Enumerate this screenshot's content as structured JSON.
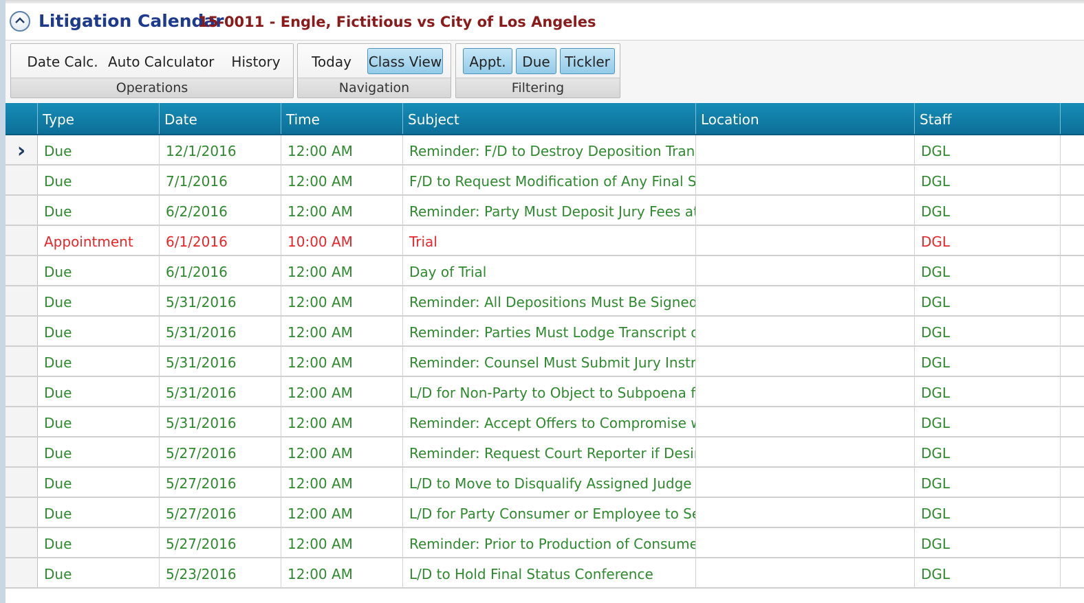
{
  "header": {
    "title": "Litigation Calendar",
    "case": "15-0011 - Engle, Fictitious vs City of Los Angeles"
  },
  "ribbon": {
    "operations": {
      "label": "Operations",
      "buttons": [
        "Date Calc.",
        "Auto Calculator",
        "History"
      ]
    },
    "navigation": {
      "label": "Navigation",
      "buttons": [
        "Today",
        "Class View"
      ],
      "active": "Class View"
    },
    "filtering": {
      "label": "Filtering",
      "buttons": [
        "Appt.",
        "Due",
        "Tickler"
      ],
      "active": [
        "Appt.",
        "Due",
        "Tickler"
      ]
    }
  },
  "grid": {
    "columns": [
      "Type",
      "Date",
      "Time",
      "Subject",
      "Location",
      "Staff"
    ],
    "current_row_indicator": "›",
    "rows": [
      {
        "type": "Due",
        "date": "12/1/2016",
        "time": "12:00 AM",
        "subject": "Reminder: F/D to Destroy Deposition Transc",
        "location": "",
        "staff": "DGL",
        "current": true
      },
      {
        "type": "Due",
        "date": "7/1/2016",
        "time": "12:00 AM",
        "subject": "F/D to Request Modification of Any Final Sta",
        "location": "",
        "staff": "DGL"
      },
      {
        "type": "Due",
        "date": "6/2/2016",
        "time": "12:00 AM",
        "subject": "Reminder: Party Must Deposit Jury Fees at B",
        "location": "",
        "staff": "DGL"
      },
      {
        "type": "Appointment",
        "date": "6/1/2016",
        "time": "10:00 AM",
        "subject": "Trial",
        "location": "",
        "staff": "DGL"
      },
      {
        "type": "Due",
        "date": "6/1/2016",
        "time": "12:00 AM",
        "subject": "Day of Trial",
        "location": "",
        "staff": "DGL"
      },
      {
        "type": "Due",
        "date": "5/31/2016",
        "time": "12:00 AM",
        "subject": "Reminder: All Depositions Must Be Signed a",
        "location": "",
        "staff": "DGL"
      },
      {
        "type": "Due",
        "date": "5/31/2016",
        "time": "12:00 AM",
        "subject": "Reminder: Parties Must Lodge Transcript of",
        "location": "",
        "staff": "DGL"
      },
      {
        "type": "Due",
        "date": "5/31/2016",
        "time": "12:00 AM",
        "subject": "Reminder: Counsel Must Submit Jury Instruc",
        "location": "",
        "staff": "DGL"
      },
      {
        "type": "Due",
        "date": "5/31/2016",
        "time": "12:00 AM",
        "subject": "L/D for Non-Party to Object to Subpoena fo",
        "location": "",
        "staff": "DGL"
      },
      {
        "type": "Due",
        "date": "5/31/2016",
        "time": "12:00 AM",
        "subject": "Reminder: Accept Offers to Compromise wit",
        "location": "",
        "staff": "DGL"
      },
      {
        "type": "Due",
        "date": "5/27/2016",
        "time": "12:00 AM",
        "subject": "Reminder: Request Court Reporter if Desired",
        "location": "",
        "staff": "DGL"
      },
      {
        "type": "Due",
        "date": "5/27/2016",
        "time": "12:00 AM",
        "subject": "L/D to Move to Disqualify Assigned Judge (C",
        "location": "",
        "staff": "DGL"
      },
      {
        "type": "Due",
        "date": "5/27/2016",
        "time": "12:00 AM",
        "subject": "L/D for Party Consumer or Employee to Serv",
        "location": "",
        "staff": "DGL"
      },
      {
        "type": "Due",
        "date": "5/27/2016",
        "time": "12:00 AM",
        "subject": "Reminder: Prior to Production of Consumer",
        "location": "",
        "staff": "DGL"
      },
      {
        "type": "Due",
        "date": "5/23/2016",
        "time": "12:00 AM",
        "subject": "L/D to Hold Final Status Conference",
        "location": "",
        "staff": "DGL"
      }
    ]
  },
  "colors": {
    "due_text": "#2f8a2f",
    "appointment_text": "#e8262a",
    "header_bg": "#0c6f98",
    "title": "#1d3a8c",
    "case_title": "#8b1a1a"
  }
}
